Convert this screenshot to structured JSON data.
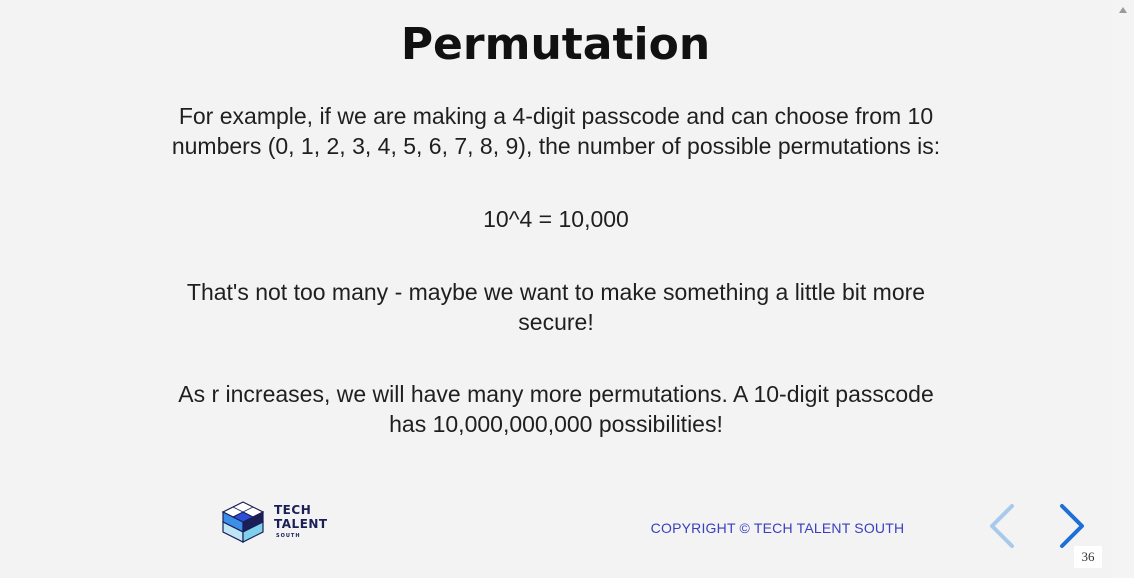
{
  "slide": {
    "title": "Permutation",
    "paragraphs": [
      "For example, if we are making a 4-digit passcode and can choose from 10 numbers (0, 1, 2, 3, 4, 5, 6, 7, 8, 9), the number of possible permutations is:",
      "10^4 = 10,000",
      "That's not too many - maybe we want to make something a little bit more secure!",
      "As r increases, we will have many more permutations. A 10-digit passcode has 10,000,000,000 possibilities!"
    ]
  },
  "footer": {
    "logo": {
      "line1": "TECH",
      "line2": "TALENT",
      "line3": "SOUTH"
    },
    "copyright": "COPYRIGHT © TECH TALENT SOUTH"
  },
  "navigation": {
    "prev_icon": "chevron-left-icon",
    "next_icon": "chevron-right-icon",
    "page_number": "36"
  },
  "colors": {
    "background": "#f2f3f2",
    "copyright": "#3a3ec0",
    "nav_prev": "#a9c9ec",
    "nav_next": "#1f6fd6",
    "logo_text": "#1b1f57"
  }
}
